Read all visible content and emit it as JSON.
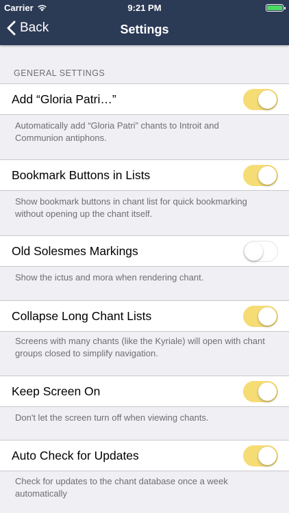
{
  "status_bar": {
    "carrier": "Carrier",
    "time": "9:21 PM",
    "battery_color": "#4cd964"
  },
  "nav": {
    "back_label": "Back",
    "title": "Settings",
    "background": "#2b3a55"
  },
  "section": {
    "header": "GENERAL SETTINGS"
  },
  "accent": "#f5dc74",
  "settings": [
    {
      "label": "Add “Gloria Patri…”",
      "enabled": true,
      "description": "Automatically add “Gloria Patri” chants to Introit and Communion antiphons."
    },
    {
      "label": "Bookmark Buttons in Lists",
      "enabled": true,
      "description": "Show bookmark buttons in chant list for quick bookmarking without opening up the chant itself."
    },
    {
      "label": "Old Solesmes Markings",
      "enabled": false,
      "description": "Show the ictus and mora when rendering chant."
    },
    {
      "label": "Collapse Long Chant Lists",
      "enabled": true,
      "description": "Screens with many chants (like the Kyriale) will open with chant groups closed to simplify navigation."
    },
    {
      "label": "Keep Screen On",
      "enabled": true,
      "description": "Don't let the screen turn off when viewing chants."
    },
    {
      "label": "Auto Check for Updates",
      "enabled": true,
      "description": "Check for updates to the chant database once a week automatically"
    }
  ]
}
